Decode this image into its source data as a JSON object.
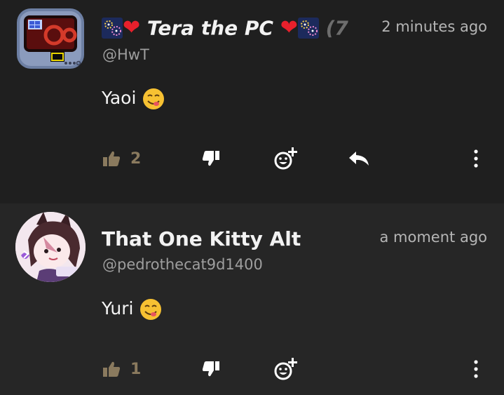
{
  "comments": [
    {
      "author_prefix": "",
      "author_name": "Tera the PC",
      "author_suffix": "(7",
      "handle": "@HwT",
      "time": "2 minutes ago",
      "text": "Yaoi",
      "text_emoji": "yum-face-emoji",
      "likes": "2"
    },
    {
      "author_name": "That One Kitty Alt",
      "handle": "@pedrothecat9d1400",
      "time": "a moment ago",
      "text": "Yuri",
      "text_emoji": "yum-face-emoji",
      "likes": "1"
    }
  ],
  "icons": {
    "like": "thumbs-up-icon",
    "dislike": "thumbs-down-icon",
    "react": "add-reaction-icon",
    "reply": "reply-icon",
    "more": "more-vertical-icon"
  },
  "colors": {
    "background": "#1f1f1f",
    "background_alt": "#262626",
    "like_tan": "#8a7a5e",
    "heart_red": "#e8202c"
  }
}
